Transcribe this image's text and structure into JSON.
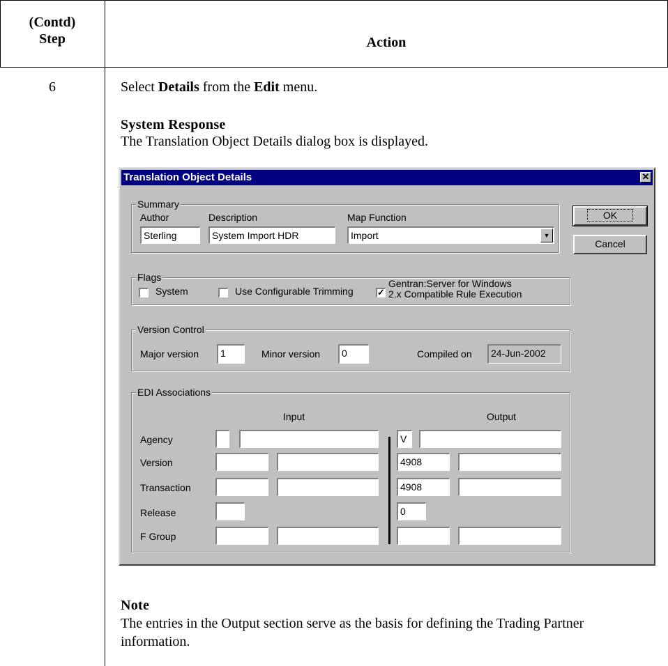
{
  "table": {
    "step_header": "(Contd)\nStep",
    "action_header": "Action",
    "step_number": "6",
    "instruction": {
      "pre": "Select ",
      "bold1": "Details",
      "mid": " from the ",
      "bold2": "Edit",
      "post": " menu."
    },
    "response_title": "System Response",
    "response_text": "The Translation Object Details dialog box is displayed.",
    "note_title": "Note",
    "note_text": "The entries in the Output section serve as the basis for defining the Trading Partner information."
  },
  "dialog": {
    "title": "Translation Object Details",
    "close_glyph": "✕",
    "ok_label": "OK",
    "cancel_label": "Cancel",
    "summary": {
      "group_label": "Summary",
      "author_label": "Author",
      "description_label": "Description",
      "map_function_label": "Map Function",
      "author_value": "Sterling",
      "description_value": "System Import HDR",
      "map_function_value": "Import"
    },
    "flags": {
      "group_label": "Flags",
      "system_label": "System",
      "system_checked": false,
      "trimming_label": "Use Configurable Trimming",
      "trimming_checked": false,
      "gentran_label_line1": "Gentran:Server for Windows",
      "gentran_label_line2": "2.x Compatible Rule Execution",
      "gentran_checked": true,
      "check_glyph": "✓"
    },
    "version_control": {
      "group_label": "Version Control",
      "major_label": "Major version",
      "major_value": "1",
      "minor_label": "Minor version",
      "minor_value": "0",
      "compiled_label": "Compiled on",
      "compiled_value": "24-Jun-2002"
    },
    "edi": {
      "group_label": "EDI Associations",
      "input_header": "Input",
      "output_header": "Output",
      "rows": [
        {
          "label": "Agency",
          "in1": "",
          "in2": "",
          "out1": "V",
          "out2": ""
        },
        {
          "label": "Version",
          "in1": "",
          "in2": "",
          "out1": "4908",
          "out2": ""
        },
        {
          "label": "Transaction",
          "in1": "",
          "in2": "",
          "out1": "4908",
          "out2": ""
        },
        {
          "label": "Release",
          "in1": "",
          "in2": "",
          "out1": "0",
          "out2": ""
        },
        {
          "label": "F Group",
          "in1": "",
          "in2": "",
          "out1": "",
          "out2": ""
        }
      ]
    }
  }
}
